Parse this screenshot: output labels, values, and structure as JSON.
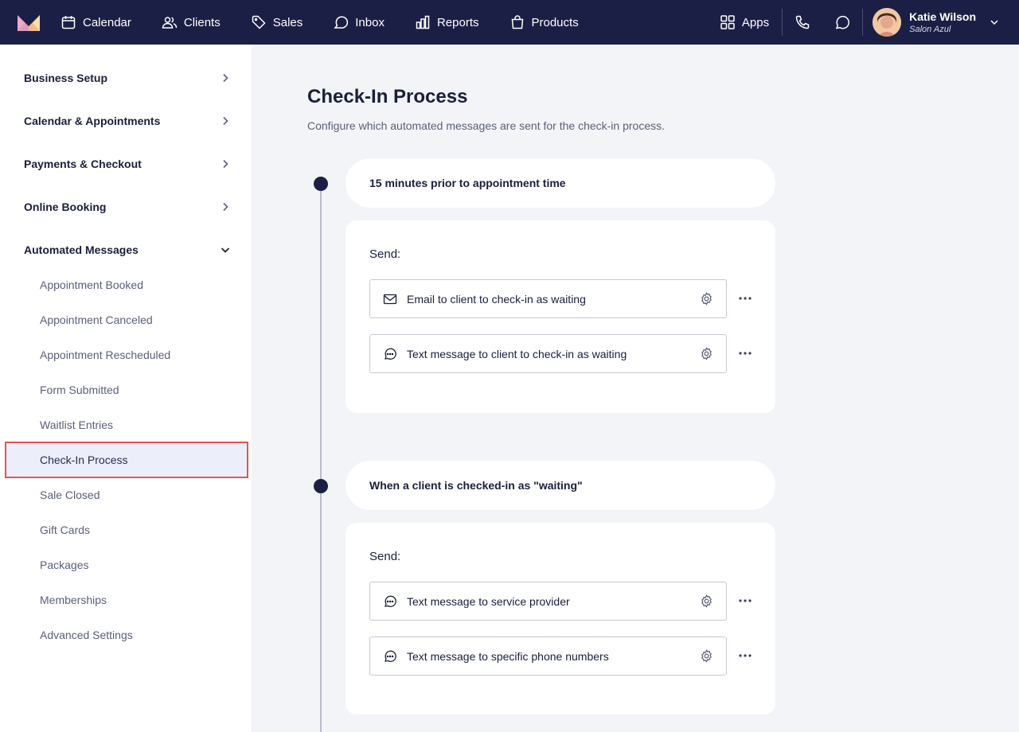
{
  "nav": {
    "items": [
      {
        "label": "Calendar",
        "icon": "calendar-icon"
      },
      {
        "label": "Clients",
        "icon": "users-icon"
      },
      {
        "label": "Sales",
        "icon": "tag-icon"
      },
      {
        "label": "Inbox",
        "icon": "inbox-icon"
      },
      {
        "label": "Reports",
        "icon": "bar-chart-icon"
      },
      {
        "label": "Products",
        "icon": "bag-icon"
      }
    ],
    "apps_label": "Apps",
    "user_name": "Katie Wilson",
    "user_subtitle": "Salon Azul"
  },
  "sidebar": {
    "sections": [
      {
        "label": "Business Setup",
        "expanded": false
      },
      {
        "label": "Calendar & Appointments",
        "expanded": false
      },
      {
        "label": "Payments & Checkout",
        "expanded": false
      },
      {
        "label": "Online Booking",
        "expanded": false
      },
      {
        "label": "Automated Messages",
        "expanded": true
      }
    ],
    "sub_items": [
      "Appointment Booked",
      "Appointment Canceled",
      "Appointment Rescheduled",
      "Form Submitted",
      "Waitlist Entries",
      "Check-In Process",
      "Sale Closed",
      "Gift Cards",
      "Packages",
      "Memberships",
      "Advanced Settings"
    ],
    "active_item": "Check-In Process"
  },
  "main": {
    "title": "Check-In Process",
    "description": "Configure which automated messages are sent for the check-in process.",
    "send_label": "Send:",
    "steps": [
      {
        "trigger": "15 minutes prior to appointment time",
        "messages": [
          {
            "label": "Email to client to check-in as waiting",
            "icon": "email-icon"
          },
          {
            "label": "Text message to client to check-in as waiting",
            "icon": "chat-icon"
          }
        ]
      },
      {
        "trigger": "When a client is checked-in as \"waiting\"",
        "messages": [
          {
            "label": "Text message to service provider",
            "icon": "chat-icon"
          },
          {
            "label": "Text message to specific phone numbers",
            "icon": "chat-icon"
          }
        ]
      }
    ]
  },
  "colors": {
    "nav_bg": "#1c1f45",
    "page_bg": "#f3f4f7",
    "active_border": "#e0574a",
    "active_bg": "#eceefa"
  }
}
